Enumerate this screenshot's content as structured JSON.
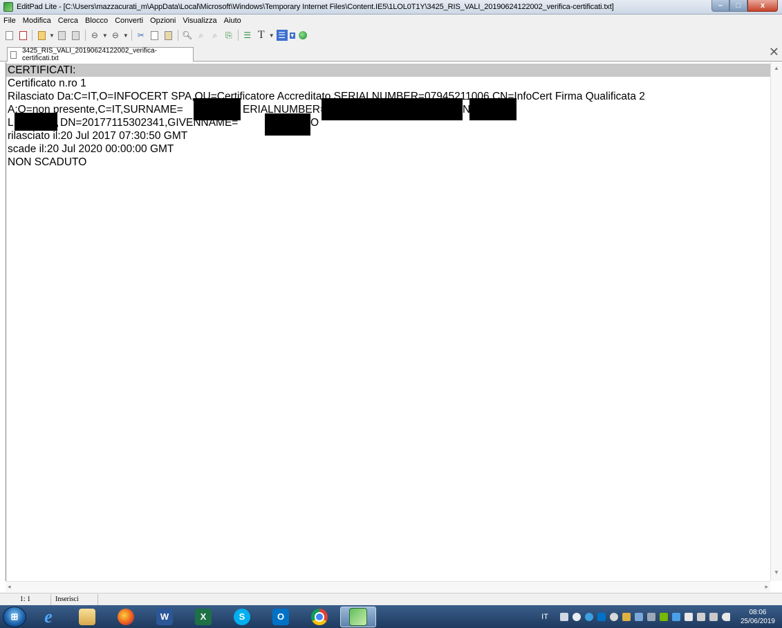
{
  "window": {
    "title": "EditPad Lite - [C:\\Users\\mazzacurati_m\\AppData\\Local\\Microsoft\\Windows\\Temporary Internet Files\\Content.IE5\\1LOL0T1Y\\3425_RIS_VALI_20190624122002_verifica-certificati.txt]",
    "min_label": "–",
    "max_label": "□",
    "close_label": "x"
  },
  "menu": [
    "File",
    "Modifica",
    "Cerca",
    "Blocco",
    "Converti",
    "Opzioni",
    "Visualizza",
    "Aiuto"
  ],
  "tab": {
    "label": "3425_RIS_VALI_20190624122002_verifica-certificati.txt",
    "close_label": "✕"
  },
  "editor": {
    "lines": [
      "CERTIFICATI:",
      "Certificato n.ro 1",
      "Rilasciato Da:C=IT,O=INFOCERT SPA,OU=Certificatore Accreditato,SERIALNUMBER=07945211006,CN=InfoCert Firma Qualificata 2",
      "A:O=non presente,C=IT,SURNAME=",
      "DN=20177115302341,GIVENNAME=",
      "rilasciato il:20 Jul 2017 07:30:50 GMT",
      "scade il:20 Jul 2020 00:00:00 GMT",
      "NON SCADUTO"
    ],
    "line4_fragments": [
      "ERIALNUMBER=",
      "N="
    ],
    "line5_fragments": [
      "L",
      ",",
      "O"
    ]
  },
  "status": {
    "position": "1: 1",
    "mode": "Inserisci"
  },
  "taskbar": {
    "language": "IT",
    "time": "08:06",
    "date": "25/06/2019",
    "apps": [
      "internet-explorer",
      "file-explorer",
      "firefox",
      "word",
      "excel",
      "skype",
      "outlook",
      "chrome",
      "editpad"
    ]
  }
}
